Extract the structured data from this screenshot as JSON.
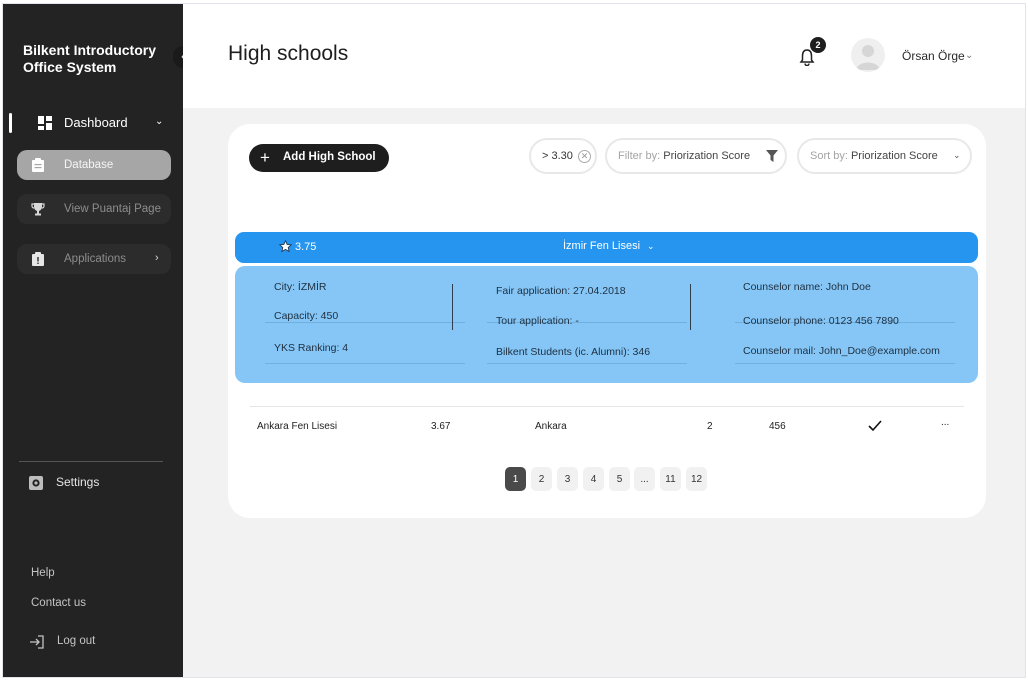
{
  "app": {
    "title": "Bilkent Introductory Office System"
  },
  "sidebar": {
    "dashboard_label": "Dashboard",
    "items": [
      {
        "label": "Database",
        "icon": "clipboard-icon",
        "active": true
      },
      {
        "label": "View Puantaj Page",
        "icon": "trophy-icon",
        "active": false
      },
      {
        "label": "Applications",
        "icon": "clipboard-alert-icon",
        "active": false
      }
    ],
    "settings_label": "Settings",
    "help_label": "Help",
    "contact_label": "Contact us",
    "logout_label": "Log out"
  },
  "header": {
    "page_title": "High schools",
    "notification_count": "2",
    "user_name": "Örsan Örge"
  },
  "toolbar": {
    "add_label": "Add High School",
    "score_filter_value": "> 3.30",
    "filter_prefix": "Filter by:",
    "filter_value": "Priorization Score",
    "sort_prefix": "Sort by:",
    "sort_value": "Priorization Score"
  },
  "expanded_school": {
    "score": "3.75",
    "name": "İzmir Fen Lisesi",
    "city": "City: İZMİR",
    "capacity": "Capacity: 450",
    "yks_ranking": "YKS Ranking: 4",
    "fair_application": "Fair application: 27.04.2018",
    "tour_application": "Tour application: -",
    "bilkent_students": "Bilkent Students (ic. Alumni): 346",
    "counselor_name": "Counselor name: John Doe",
    "counselor_phone": "Counselor phone: 0123 456 7890",
    "counselor_mail": "Counselor mail: John_Doe@example.com"
  },
  "table": {
    "rows": [
      {
        "name": "Ankara Fen Lisesi",
        "score": "3.67",
        "city": "Ankara",
        "col4": "2",
        "col5": "456",
        "checked": true,
        "more": "..."
      }
    ]
  },
  "pagination": {
    "pages": [
      "1",
      "2",
      "3",
      "4",
      "5",
      "...",
      "11",
      "12"
    ],
    "current": "1"
  },
  "colors": {
    "sidebar_bg": "#232323",
    "accent_blue": "#2595f0",
    "detail_blue": "#85c6f6",
    "dark_button": "#1e1e1e"
  }
}
